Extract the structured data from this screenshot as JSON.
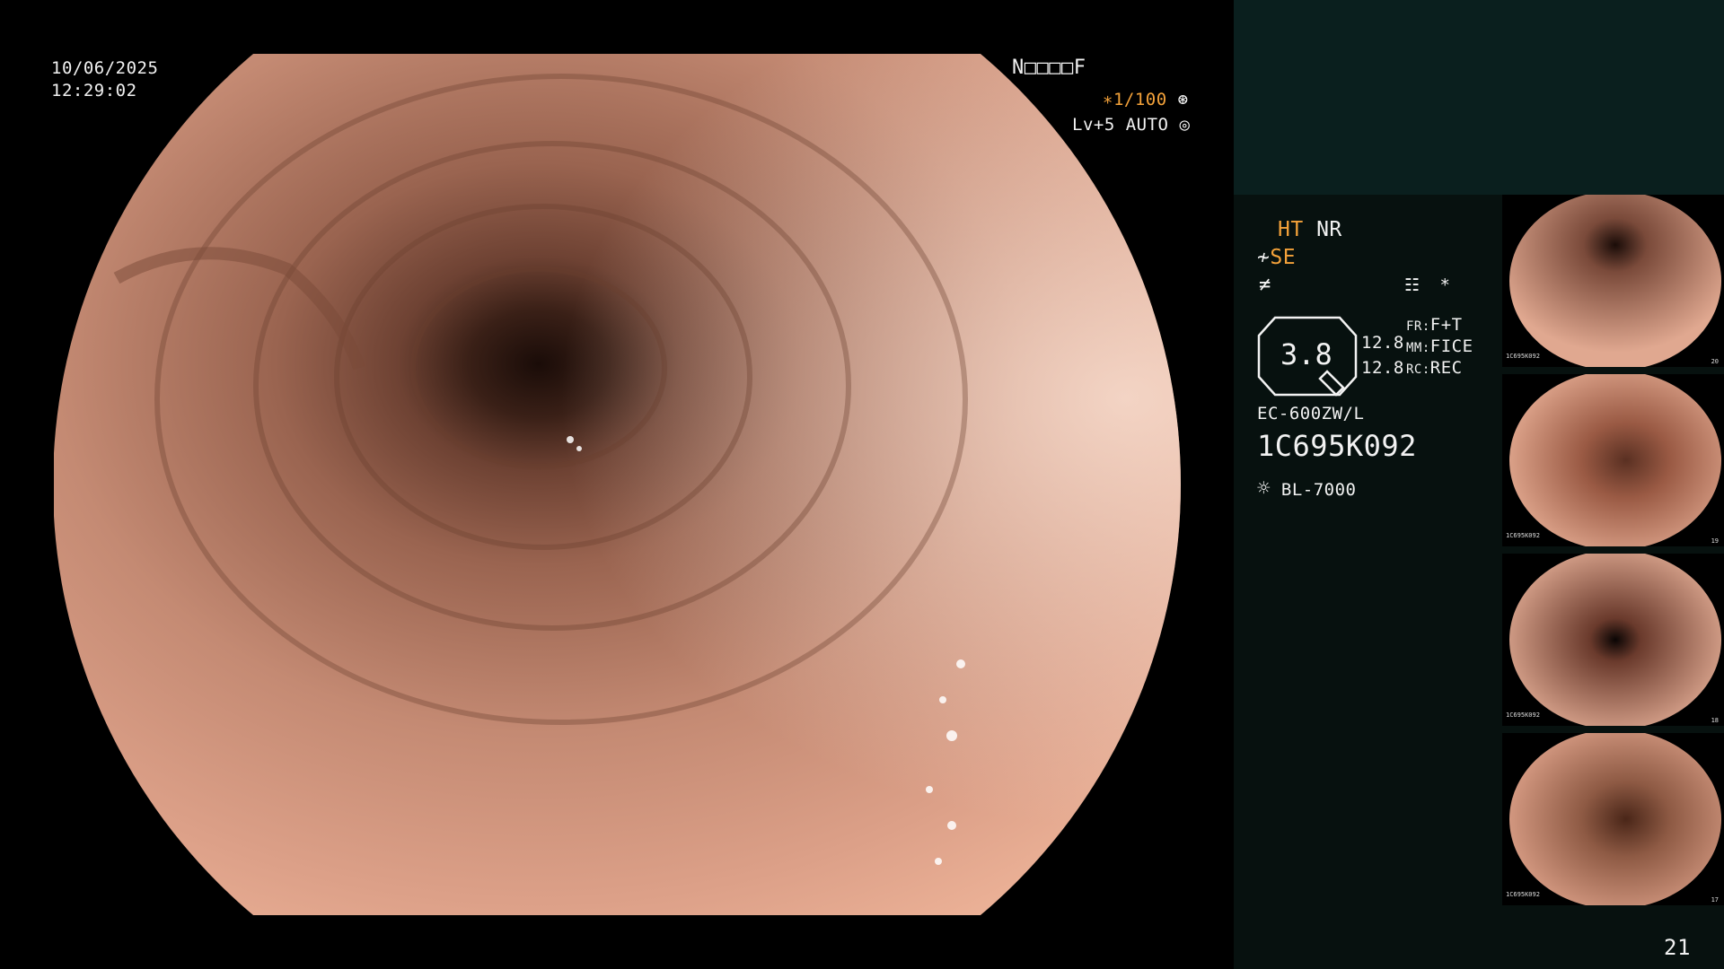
{
  "osd": {
    "date": "10/06/2025",
    "time": "12:29:02",
    "patient_code": "N□□□□F",
    "shutter": "∗1/100",
    "level": "Lv+5",
    "mode": "AUTO"
  },
  "panel": {
    "ht": "HT",
    "nr": "NR",
    "se": "SE",
    "gauge_value": "3.8",
    "val1": "12.8",
    "val2": "12.8",
    "fr_label": "FR:",
    "fr_value": "F+T",
    "mm_label": "MM:",
    "mm_value": "FICE",
    "rc_label": "RC:",
    "rc_value": "REC",
    "scope_model": "EC-600ZW/L",
    "serial": "1C695K092",
    "light_source": "BL-7000",
    "asterisk": "*",
    "page_number": "21"
  },
  "thumbnails": [
    {
      "label": "1C695K092",
      "num": "20"
    },
    {
      "label": "1C695K092",
      "num": "19"
    },
    {
      "label": "1C695K092",
      "num": "18"
    },
    {
      "label": "1C695K092",
      "num": "17"
    }
  ],
  "colors": {
    "osd_accent": "#f4a23a",
    "panel_bg": "#07110f",
    "panel_header": "#0a1f1e"
  }
}
